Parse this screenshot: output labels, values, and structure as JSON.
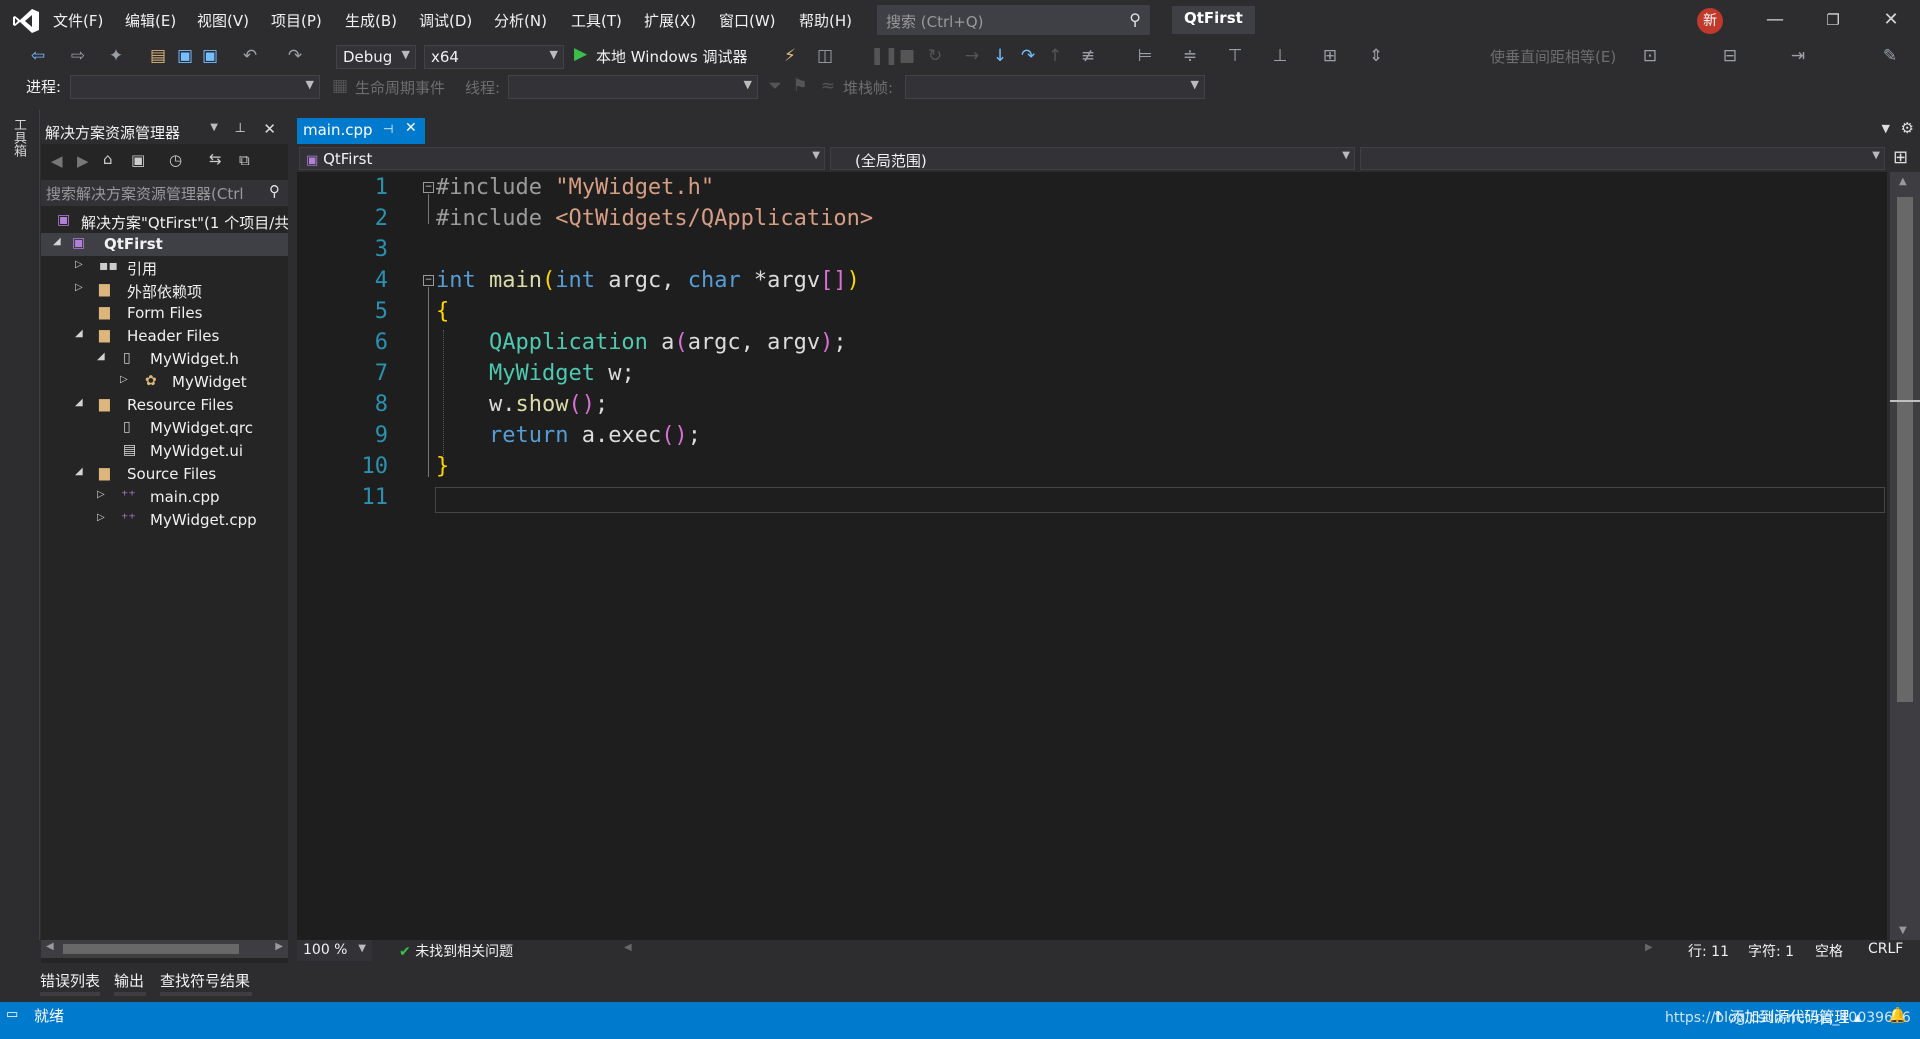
{
  "menu": [
    "文件(F)",
    "编辑(E)",
    "视图(V)",
    "项目(P)",
    "生成(B)",
    "调试(D)",
    "分析(N)",
    "工具(T)",
    "扩展(X)",
    "窗口(W)",
    "帮助(H)"
  ],
  "search": {
    "placeholder": "搜索 (Ctrl+Q)"
  },
  "title": "QtFirst",
  "new_badge": "新",
  "toolbar": {
    "config": "Debug",
    "platform": "x64",
    "run_label": "本地 Windows 调试器",
    "spacing_label": "使垂直间距相等(E)"
  },
  "debug_toolbar": {
    "process_label": "进程:",
    "lifecycle_label": "生命周期事件",
    "thread_label": "线程:",
    "stackframe_label": "堆栈帧:"
  },
  "toolbox_tab": "工具箱",
  "solution_explorer": {
    "title": "解决方案资源管理器",
    "search_placeholder": "搜索解决方案资源管理器(Ctrl",
    "items": [
      {
        "label": "解决方案\"QtFirst\"(1 个项目/共"
      },
      {
        "label": "QtFirst"
      },
      {
        "label": "引用"
      },
      {
        "label": "外部依赖项"
      },
      {
        "label": "Form Files"
      },
      {
        "label": "Header Files"
      },
      {
        "label": "MyWidget.h"
      },
      {
        "label": "MyWidget"
      },
      {
        "label": "Resource Files"
      },
      {
        "label": "MyWidget.qrc"
      },
      {
        "label": "MyWidget.ui"
      },
      {
        "label": "Source Files"
      },
      {
        "label": "main.cpp"
      },
      {
        "label": "MyWidget.cpp"
      }
    ]
  },
  "editor": {
    "tab": "main.cpp",
    "nav_project": "QtFirst",
    "nav_scope": "(全局范围)",
    "line_numbers": [
      "1",
      "2",
      "3",
      "4",
      "5",
      "6",
      "7",
      "8",
      "9",
      "10",
      "11"
    ],
    "code": {
      "l1_dir": "#include",
      "l1_str": "\"MyWidget.h\"",
      "l2_dir": "#include",
      "l2_str": "<QtWidgets/QApplication>",
      "l4_int": "int",
      "l4_main": " main",
      "l4_open": "(",
      "l4_int2": "int",
      "l4_argc": " argc, ",
      "l4_char": "char",
      "l4_argv": " *argv",
      "l4_sq": "[]",
      "l4_close": ")",
      "l5": "{",
      "l6_type": "QApplication",
      "l6_rest1": " a",
      "l6_open": "(",
      "l6_args": "argc, argv",
      "l6_close": ")",
      "l6_end": ";",
      "l7_type": "MyWidget",
      "l7_rest": " w;",
      "l8_obj": "w.",
      "l8_fn": "show",
      "l8_paren": "()",
      "l8_end": ";",
      "l9_ret": "return",
      "l9_rest": " a.exec",
      "l9_paren": "()",
      "l9_end": ";",
      "l10": "}"
    }
  },
  "editor_status": {
    "zoom": "100 %",
    "issues": "未找到相关问题",
    "line": "行: 11",
    "char": "字符: 1",
    "spaces": "空格",
    "eol": "CRLF"
  },
  "bottom_tabs": [
    "错误列表",
    "输出",
    "查找符号结果"
  ],
  "statusbar": {
    "ready": "就绪",
    "scm": "↑ 添加到源代码管理 ▴",
    "url": "https://blog.csdn.net/qq_40039656"
  },
  "colors": {
    "accent": "#007acc",
    "editor_bg": "#1e1e1e",
    "chrome_bg": "#2d2d30"
  }
}
